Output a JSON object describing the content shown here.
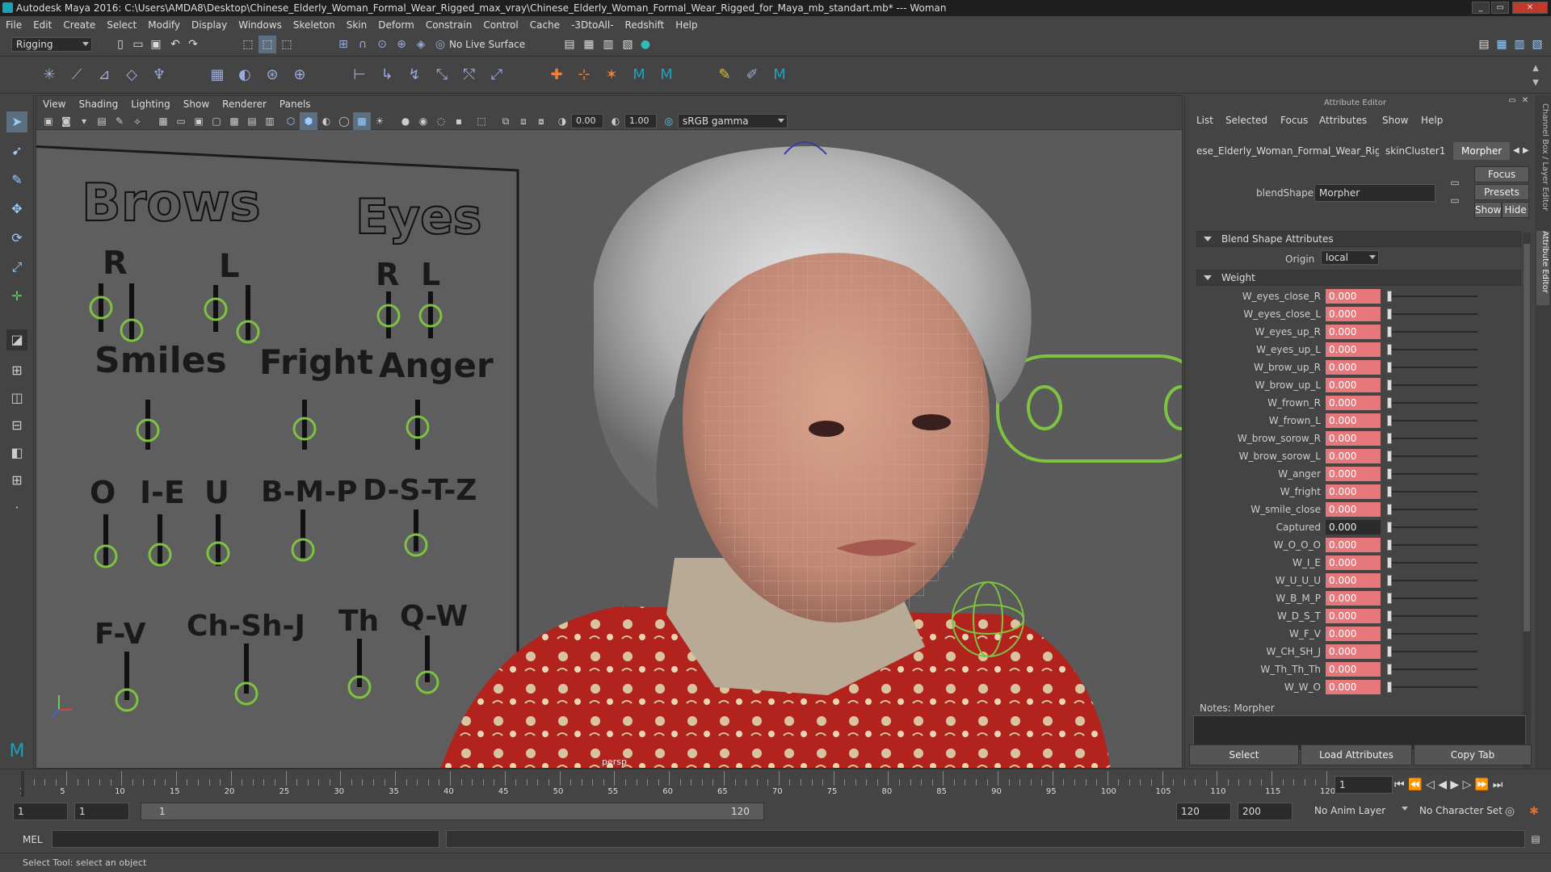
{
  "title": "Autodesk Maya 2016: C:\\Users\\AMDA8\\Desktop\\Chinese_Elderly_Woman_Formal_Wear_Rigged_max_vray\\Chinese_Elderly_Woman_Formal_Wear_Rigged_for_Maya_mb_standart.mb*  ---  Woman",
  "window_buttons": [
    "_",
    "▭",
    "✕"
  ],
  "menus": [
    "File",
    "Edit",
    "Create",
    "Select",
    "Modify",
    "Display",
    "Windows",
    "Skeleton",
    "Skin",
    "Deform",
    "Constrain",
    "Control",
    "Cache",
    "-3DtoAll-",
    "Redshift",
    "Help"
  ],
  "status": {
    "mode": "Rigging",
    "live_surface": "No Live Surface"
  },
  "viewport": {
    "menus": [
      "View",
      "Shading",
      "Lighting",
      "Show",
      "Renderer",
      "Panels"
    ],
    "field1": "0.00",
    "field2": "1.00",
    "color_space": "sRGB gamma",
    "camera_label": "persp",
    "board": {
      "brows": "Brows",
      "eyes": "Eyes",
      "r": "R",
      "l": "L",
      "smiles": "Smiles",
      "fright": "Fright",
      "anger": "Anger",
      "o": "O",
      "ie": "I-E",
      "u": "U",
      "bmp": "B-M-P",
      "dstz": "D-S-T-Z",
      "fv": "F-V",
      "chshj": "Ch-Sh-J",
      "th": "Th",
      "qw": "Q-W"
    }
  },
  "attribute_editor": {
    "header": "Attribute Editor",
    "menus": [
      "List",
      "Selected",
      "Focus",
      "Attributes",
      "Show",
      "Help"
    ],
    "tabs": [
      "ese_Elderly_Woman_Formal_Wear_Rigged",
      "skinCluster1",
      "Morpher"
    ],
    "blendshape_label": "blendShape:",
    "blendshape_value": "Morpher",
    "focus_btn": "Focus",
    "presets_btn": "Presets",
    "show_btn": "Show",
    "hide_btn": "Hide",
    "section_blend": "Blend Shape Attributes",
    "origin_label": "Origin",
    "origin_value": "local",
    "section_weight": "Weight",
    "weights": [
      {
        "name": "W_eyes_close_R",
        "value": "0.000"
      },
      {
        "name": "W_eyes_close_L",
        "value": "0.000"
      },
      {
        "name": "W_eyes_up_R",
        "value": "0.000"
      },
      {
        "name": "W_eyes_up_L",
        "value": "0.000"
      },
      {
        "name": "W_brow_up_R",
        "value": "0.000"
      },
      {
        "name": "W_brow_up_L",
        "value": "0.000"
      },
      {
        "name": "W_frown_R",
        "value": "0.000"
      },
      {
        "name": "W_frown_L",
        "value": "0.000"
      },
      {
        "name": "W_brow_sorow_R",
        "value": "0.000"
      },
      {
        "name": "W_brow_sorow_L",
        "value": "0.000"
      },
      {
        "name": "W_anger",
        "value": "0.000"
      },
      {
        "name": "W_fright",
        "value": "0.000"
      },
      {
        "name": "W_smile_close",
        "value": "0.000"
      },
      {
        "name": "Captured",
        "value": "0.000"
      },
      {
        "name": "W_O_O_O",
        "value": "0.000"
      },
      {
        "name": "W_I_E",
        "value": "0.000"
      },
      {
        "name": "W_U_U_U",
        "value": "0.000"
      },
      {
        "name": "W_B_M_P",
        "value": "0.000"
      },
      {
        "name": "W_D_S_T",
        "value": "0.000"
      },
      {
        "name": "W_F_V",
        "value": "0.000"
      },
      {
        "name": "W_CH_SH_J",
        "value": "0.000"
      },
      {
        "name": "W_Th_Th_Th",
        "value": "0.000"
      },
      {
        "name": "W_W_O",
        "value": "0.000"
      }
    ],
    "notes_label": "Notes:",
    "notes_value": "Morpher",
    "select_btn": "Select",
    "load_btn": "Load Attributes",
    "copy_btn": "Copy Tab",
    "side_tabs": [
      "Channel Box / Layer Editor",
      "Attribute Editor"
    ]
  },
  "timeline": {
    "ticks": [
      "5",
      "10",
      "15",
      "20",
      "25",
      "30",
      "35",
      "40",
      "45",
      "50",
      "55",
      "60",
      "65",
      "70",
      "75",
      "80",
      "85",
      "90",
      "95",
      "100",
      "105",
      "110",
      "115",
      "120"
    ],
    "current_frame": "1",
    "start_tick": "1"
  },
  "range": {
    "start": "1",
    "start2": "1",
    "slider_start": "1",
    "slider_end": "120",
    "end": "120",
    "end2": "200",
    "anim_layer": "No Anim Layer",
    "char_set": "No Character Set"
  },
  "cmd": {
    "label": "MEL"
  },
  "help_text": "Select Tool: select an object",
  "colors": {
    "wire": "#59e07a",
    "weight_field": "#e6787c",
    "ctrl": "#7ec241"
  }
}
